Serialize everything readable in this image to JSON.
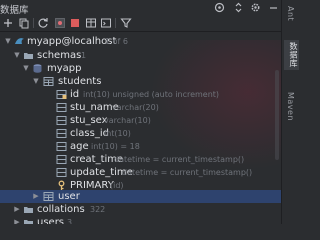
{
  "panel": {
    "title": "数据库"
  },
  "rightbar": {
    "tab1": "Ant",
    "tab2": "数据库",
    "tab3": "Maven"
  },
  "tree": {
    "root": {
      "label": "myapp@localhost",
      "meta": "1 of 6"
    },
    "schemas": {
      "label": "schemas",
      "meta": "1"
    },
    "myapp": {
      "label": "myapp"
    },
    "students": {
      "label": "students"
    },
    "columns": [
      {
        "name": "id",
        "type": "int(10) unsigned (auto increment)"
      },
      {
        "name": "stu_name",
        "type": "varchar(20)"
      },
      {
        "name": "stu_sex",
        "type": "varchar(10)"
      },
      {
        "name": "class_id",
        "type": "int(10)"
      },
      {
        "name": "age",
        "type": "int(10) = 18"
      },
      {
        "name": "creat_time",
        "type": "datetime = current_timestamp()"
      },
      {
        "name": "update_time",
        "type": "datetime = current_timestamp()"
      }
    ],
    "primary": {
      "label": "PRIMARY",
      "meta": "(id)"
    },
    "user": {
      "label": "user"
    },
    "collations": {
      "label": "collations",
      "meta": "322"
    },
    "users": {
      "label": "users",
      "meta": "3"
    }
  },
  "colors": {
    "accent": "#3574f0",
    "selected": "#2e436e",
    "table": "#7c8db5",
    "key": "#e5c07b"
  }
}
